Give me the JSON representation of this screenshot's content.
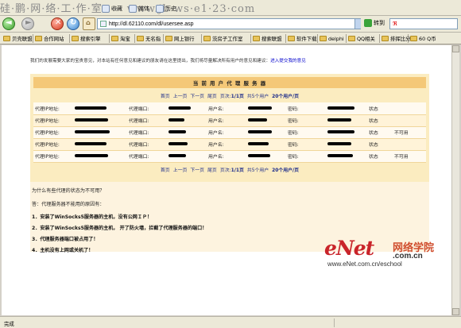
{
  "watermark_top": "硅·鹏·网·络·工·作·室 ···· www.jb·ws·e1·23·com",
  "toolbar": {
    "favorites_label": "收藏",
    "media_label": "媒体",
    "history_label": "历史"
  },
  "address": {
    "url": "http://dl.62110.com/dl/usersee.asp",
    "go_label": "转到"
  },
  "favorites": [
    "贝壳联盟",
    "合作网站",
    "搜索引擎",
    "淘宝",
    "无名指",
    "网上银行",
    "茨房子工作室",
    "搜索联盟",
    "软件下载",
    "delphi",
    "QQ相关",
    "排挥比分",
    "60 Q币"
  ],
  "intro": {
    "text": "我们的发展需要大家的宝贵意见，对本站有任何意见和建议的朋友请在这里提出，我们将尽量解决所有用户的意见和建议：",
    "link": "进入提交我的意见"
  },
  "panel": {
    "title": "当 前 用 户 代 理 服 务 器",
    "pager": {
      "first": "首页",
      "prev": "上一页",
      "next": "下一页",
      "last": "尾页",
      "page_label": "页次:",
      "page_value": "1/1页",
      "total_label": "共5个用户",
      "per_page": "20个用户/页"
    }
  },
  "table": {
    "ip_label": "代理IP地址:",
    "port_label": "代理端口:",
    "user_label": "用户名:",
    "pass_label": "密码:",
    "state_label": "状态",
    "rows": [
      {
        "status": ""
      },
      {
        "status": ""
      },
      {
        "status": "不可用"
      },
      {
        "status": ""
      },
      {
        "status": "不可用"
      }
    ]
  },
  "faq": {
    "question": "为什么有些代理的状态为不可用？",
    "answer_intro": "答：代理服务器不能用的原因有：",
    "items": [
      "1．安装了WinSocks5服务器的主机，没有公网ＩＰ！",
      "2．安装了WinSocks5服务器的主机， 开了防火墙，拦截了代理服务器的端口！",
      "3．代理服务器端口被占用了！",
      "4．主机没有上网或关机了！"
    ]
  },
  "watermark": {
    "logo": "eNet",
    "cn": "网络学院",
    "domain": ".com.cn",
    "url": "www.eNet.com.cn/eschool"
  },
  "status": {
    "text": "完成"
  }
}
